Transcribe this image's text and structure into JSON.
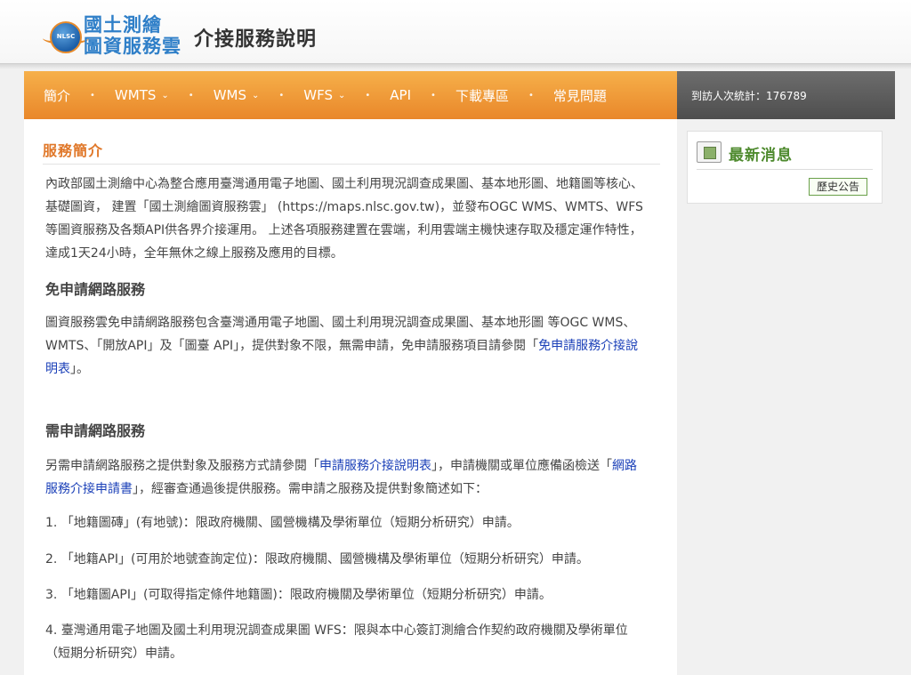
{
  "header": {
    "logo_badge": "NLSC",
    "logo_line1": "國土測繪",
    "logo_line2": "圖資服務雲",
    "site_title": "介接服務說明"
  },
  "nav": {
    "items": [
      {
        "label": "簡介",
        "dropdown": false
      },
      {
        "label": "WMTS",
        "dropdown": true
      },
      {
        "label": "WMS",
        "dropdown": true
      },
      {
        "label": "WFS",
        "dropdown": true
      },
      {
        "label": "API",
        "dropdown": false
      },
      {
        "label": "下載專區",
        "dropdown": false
      },
      {
        "label": "常見問題",
        "dropdown": false
      }
    ],
    "separator": "•",
    "chevron": "⌄"
  },
  "visitor": {
    "label": "到訪人次統計：176789"
  },
  "main": {
    "section_title": "服務簡介",
    "intro": "內政部國土測繪中心為整合應用臺灣通用電子地圖、國土利用現況調查成果圖、基本地形圖、地籍圖等核心、基礎圖資， 建置「國土測繪圖資服務雲」 (https://maps.nlsc.gov.tw)，並發布OGC WMS、WMTS、WFS等圖資服務及各類API供各界介接運用。 上述各項服務建置在雲端，利用雲端主機快速存取及穩定運作特性，達成1天24小時，全年無休之線上服務及應用的目標。",
    "free_heading": "免申請網路服務",
    "free_text_1": "圖資服務雲免申請網路服務包含臺灣通用電子地圖、國土利用現況調查成果圖、基本地形圖 等OGC WMS、 WMTS、「開放API」及「圖臺 API」，提供對象不限，無需申請，免申請服務項目請參閱「",
    "free_link": "免申請服務介接說明表",
    "free_text_2": "」。",
    "apply_heading": "需申請網路服務",
    "apply_text_1": "另需申請網路服務之提供對象及服務方式請參閱「",
    "apply_link_1": "申請服務介接說明表",
    "apply_text_2": "」，申請機關或單位應備函檢送「",
    "apply_link_2": "網路服務介接申請書",
    "apply_text_3": "」，經審查通過後提供服務。需申請之服務及提供對象簡述如下：",
    "list": [
      "1. 「地籍圖磚」(有地號)：限政府機關、國營機構及學術單位（短期分析研究）申請。",
      "2. 「地籍API」(可用於地號查詢定位)：限政府機關、國營機構及學術單位（短期分析研究）申請。",
      "3. 「地籍圖API」(可取得指定條件地籍圖)：限政府機關及學術單位（短期分析研究）申請。",
      "4. 臺灣通用電子地圖及國土利用現況調查成果圖 WFS：限與本中心簽訂測繪合作契約政府機關及學術單位（短期分析研究）申請。"
    ]
  },
  "sidebar": {
    "news_title": "最新消息",
    "history_button": "歷史公告"
  },
  "colors": {
    "nav_orange": "#e9872a",
    "title_orange": "#e0782a",
    "link_blue": "#1b40b8",
    "news_green": "#4e8a2e",
    "logo_blue": "#2f7fc8"
  }
}
